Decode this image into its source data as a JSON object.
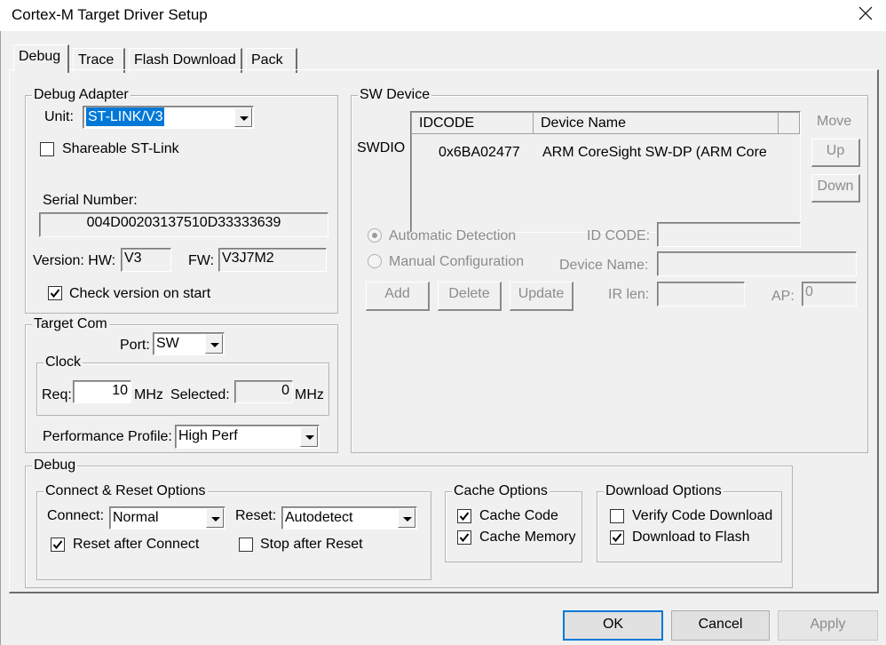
{
  "window": {
    "title": "Cortex-M Target Driver Setup",
    "close_glyph": "✕"
  },
  "tabs": [
    {
      "label": "Debug",
      "active": true
    },
    {
      "label": "Trace",
      "active": false
    },
    {
      "label": "Flash Download",
      "active": false
    },
    {
      "label": "Pack",
      "active": false
    }
  ],
  "debug_adapter": {
    "legend": "Debug Adapter",
    "unit_label": "Unit:",
    "unit_value": "ST-LINK/V3",
    "shareable_label": "Shareable ST-Link",
    "shareable_checked": false,
    "serial_label": "Serial Number:",
    "serial_value": "004D00203137510D33333639",
    "version_label": "Version: HW:",
    "hw_value": "V3",
    "fw_label": "FW:",
    "fw_value": "V3J7M2",
    "check_version_label": "Check version on start",
    "check_version_checked": true
  },
  "target_com": {
    "legend": "Target Com",
    "port_label": "Port:",
    "port_value": "SW",
    "clock": {
      "legend": "Clock",
      "req_label": "Req:",
      "req_value": "10",
      "req_unit": "MHz",
      "selected_label": "Selected:",
      "selected_value": "0",
      "selected_unit": "MHz"
    },
    "perf_label": "Performance Profile:",
    "perf_value": "High Perf"
  },
  "sw_device": {
    "legend": "SW Device",
    "swdio_label": "SWDIO",
    "columns": [
      "IDCODE",
      "Device Name"
    ],
    "rows": [
      {
        "idcode": "0x6BA02477",
        "device_name": "ARM CoreSight SW-DP (ARM Core"
      }
    ],
    "move_label": "Move",
    "up_label": "Up",
    "down_label": "Down",
    "auto_detect_label": "Automatic Detection",
    "manual_config_label": "Manual Configuration",
    "auto_detect_selected": true,
    "idcode_label": "ID CODE:",
    "device_name_label": "Device Name:",
    "irlen_label": "IR len:",
    "ap_label": "AP:",
    "ap_value": "0",
    "add_label": "Add",
    "delete_label": "Delete",
    "update_label": "Update"
  },
  "debug": {
    "legend": "Debug",
    "connect_reset": {
      "legend": "Connect & Reset Options",
      "connect_label": "Connect:",
      "connect_value": "Normal",
      "reset_label": "Reset:",
      "reset_value": "Autodetect",
      "reset_after_connect_label": "Reset after Connect",
      "reset_after_connect_checked": true,
      "stop_after_reset_label": "Stop after Reset",
      "stop_after_reset_checked": false
    },
    "cache": {
      "legend": "Cache Options",
      "cache_code_label": "Cache Code",
      "cache_code_checked": true,
      "cache_memory_label": "Cache Memory",
      "cache_memory_checked": true
    },
    "download": {
      "legend": "Download Options",
      "verify_label": "Verify Code Download",
      "verify_checked": false,
      "download_flash_label": "Download to Flash",
      "download_flash_checked": true
    }
  },
  "buttons": {
    "ok": "OK",
    "cancel": "Cancel",
    "apply": "Apply"
  },
  "colors": {
    "accent": "#0078d7",
    "disabled_text": "#8c8c8c",
    "dialog_bg": "#f0f0f0"
  }
}
